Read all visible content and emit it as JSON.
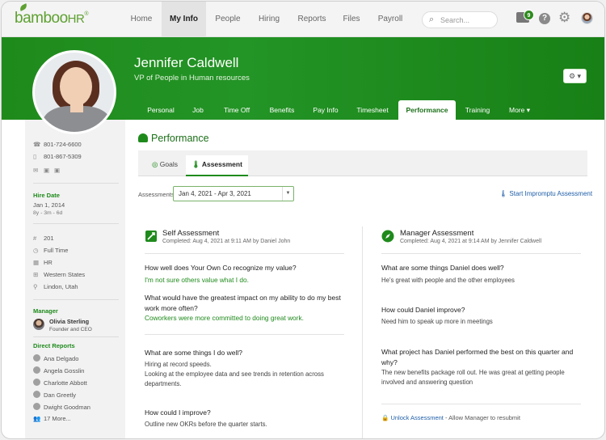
{
  "nav": {
    "logo_main": "bamboo",
    "logo_hr": "HR",
    "logo_reg": "®",
    "items": [
      {
        "label": "Home"
      },
      {
        "label": "My Info"
      },
      {
        "label": "People"
      },
      {
        "label": "Hiring"
      },
      {
        "label": "Reports"
      },
      {
        "label": "Files"
      },
      {
        "label": "Payroll"
      }
    ],
    "active": "My Info",
    "search_placeholder": "Search...",
    "inbox_count": "9",
    "help_glyph": "?"
  },
  "profile": {
    "name": "Jennifer Caldwell",
    "title": "VP of People in Human resources",
    "settings_glyph": "⚙ ▾",
    "tabs": [
      "Personal",
      "Job",
      "Time Off",
      "Benefits",
      "Pay Info",
      "Timesheet",
      "Performance",
      "Training",
      "More ▾"
    ],
    "active_tab": "Performance"
  },
  "sidebar": {
    "work_phone": "801-724-6600",
    "mobile_phone": "801-867-5309",
    "hire_date_label": "Hire Date",
    "hire_date": "Jan 1, 2014",
    "tenure": "8y - 3m - 6d",
    "employee_number": "201",
    "employment_type": "Full Time",
    "department": "HR",
    "division": "Western States",
    "location": "Lindon, Utah",
    "manager_label": "Manager",
    "manager_name": "Olivia Sterling",
    "manager_title": "Founder and CEO",
    "direct_reports_label": "Direct Reports",
    "direct_reports": [
      "Ana Delgado",
      "Angela Gosslin",
      "Charlotte Abbott",
      "Dan Greetly",
      "Dwight Goodman"
    ],
    "more_reports": "17 More..."
  },
  "performance": {
    "title": "Performance",
    "subtabs": [
      "Goals",
      "Assessment"
    ],
    "active_subtab": "Assessment",
    "assessments_label": "Assessments",
    "selected_range": "Jan 4, 2021 - Apr 3, 2021",
    "start_link": "Start Impromptu Assessment",
    "self": {
      "title": "Self Assessment",
      "completed": "Completed: Aug 4, 2021 at 9:11 AM by Daniel John",
      "q1": "How well does Your Own Co recognize my value?",
      "a1": "I'm not sure others value what I do.",
      "q2": "What would have the greatest impact on my ability to do my best work more often?",
      "a2": "Coworkers were more committed to doing great work.",
      "q3": "What are some things I do well?",
      "a3": "Hiring at record speeds.\nLooking at the employee data and see trends in retention across departments.",
      "q4": "How could I improve?",
      "a4": "Outline new OKRs before the quarter starts."
    },
    "manager": {
      "title": "Manager Assessment",
      "completed": "Completed: Aug 4, 2021 at 9:14 AM by Jennifer Caldwell",
      "q1": "What are some things Daniel does well?",
      "a1": "He's great with people and the other employees",
      "q2": "How could Daniel improve?",
      "a2": "Need him to speak up more in meetings",
      "q3": "What project has Daniel performed the best on this quarter and why?",
      "a3": "The new benefits package roll out. He was great at getting people involved and answering question",
      "unlock_link": "Unlock Assessment",
      "unlock_note": " - Allow Manager to resubmit"
    }
  },
  "colors": {
    "brand_green": "#1f8a1c",
    "link_blue": "#1f5ea8"
  }
}
